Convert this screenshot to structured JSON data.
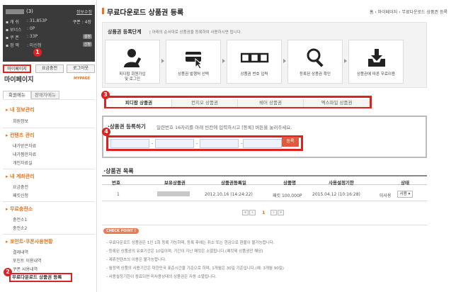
{
  "profile": {
    "username_suffix": "(3)",
    "edit_link": "정보수정",
    "rows": [
      {
        "label": "▪ 캐  쉬",
        "value": ": 31,853P"
      },
      {
        "label": "▪ 보너스",
        "value": ": 0P"
      },
      {
        "label": "▪ 쿠  폰",
        "value": ": 33P"
      },
      {
        "label": "▪ 정  액",
        "value": ": 미신청"
      }
    ],
    "coupon": "쿠폰 : 4장",
    "badge1": "설정",
    "badge2": "신청"
  },
  "profile_buttons": {
    "mypage": "마이페이지",
    "recharge": "요금충전",
    "logout": "로그아웃"
  },
  "markers": {
    "m1": "1",
    "m2": "2",
    "m3": "3",
    "m4": "4"
  },
  "sidebar": {
    "title": "마이페이지",
    "title_en": "MYPAGE",
    "tab_member": "회원메뉴",
    "tab_seller": "판매자메뉴",
    "sections": [
      {
        "title": "내 정보관리",
        "items": [
          "회원정보"
        ]
      },
      {
        "title": "컨텐츠 관리",
        "items": [
          "내가받은자료",
          "내가찜한자료",
          "개인자료실"
        ]
      },
      {
        "title": "내 계좌관리",
        "items": [
          "요금충전",
          "패킷신청"
        ]
      },
      {
        "title": "무료충전소",
        "items": [
          "충전소1",
          "충전소2"
        ]
      },
      {
        "title": "포인트·쿠폰사용현황",
        "items": [
          "결제내역",
          "포인트 이용내역",
          "쿠폰 사용내역"
        ]
      }
    ],
    "highlight_item": "무료다운로드 상품권 등록"
  },
  "main": {
    "title": "무료다운로드 상품권 등록",
    "breadcrumb": "홈 › 마이페이지 › 무료다운로드 상품권 등록",
    "steps_title": "상품권 등록단계",
    "steps_desc": "| 아래의 순서대로 상품권을 등록하여 사용하시면 됩니다.",
    "steps": [
      {
        "l1": "피디팝 회원가입",
        "l2": "및 로그인"
      },
      {
        "l1": "상품권 발행처 선택",
        "l2": ""
      },
      {
        "l1": "상품권 번호 입력",
        "l2": ""
      },
      {
        "l1": "등록된 상품권 확인",
        "l2": ""
      },
      {
        "l1": "상품권에 따른 무료이용",
        "l2": ""
      }
    ],
    "voucher_tabs": [
      "피디팝 상품권",
      "컨지오 상품권",
      "쉐어 상품권",
      "엑스파일 상품권"
    ],
    "reg_label": "·상품권 등록하기",
    "reg_desc": "일련번호 16자리를 아래 빈칸에 입력하시고 [등록] 버튼을 눌러주세요.",
    "reg_button": "등록",
    "list_title": "·상품권 목록",
    "table_headers": [
      "번호",
      "보유상품권",
      "상품권등록일",
      "상품명",
      "사용설정기한",
      "상태"
    ],
    "row": {
      "no": "1",
      "date": "2012.10.16 (14:24:22)",
      "product": "패킷 100,000P",
      "expire": "2015.04.12 (10:16:28)",
      "status": "미사용",
      "action": "사용 ▾"
    },
    "pager": {
      "first": "«",
      "prev": "‹",
      "page": "1",
      "next": "›",
      "last": "»"
    },
    "check_point": "CHECK POINT !",
    "notes": [
      "- 무료다운로드 상품권은 1인 1회 등록 가능하며, 등록 후에는 취소 또는 현금으로 환불이 불가능합니다.",
      "- 등록된 상품권의 유효기간은 10일이며, 기간이 지난 패킷은 소멸됩니다.(패킷제 상품권만 해당)",
      "- 제휴컨텐츠의 이용은 불가능합니다.",
      "- 월정액 상품의 사용기간은 대한민국 표준시간을 기준으로 하며, 1개월은 30일 기준입니다.(예: 3개월 90일)",
      "- 사용설정기한이 종료되면 미사용상태의 상품권은 자동 소멸됩니다."
    ]
  }
}
